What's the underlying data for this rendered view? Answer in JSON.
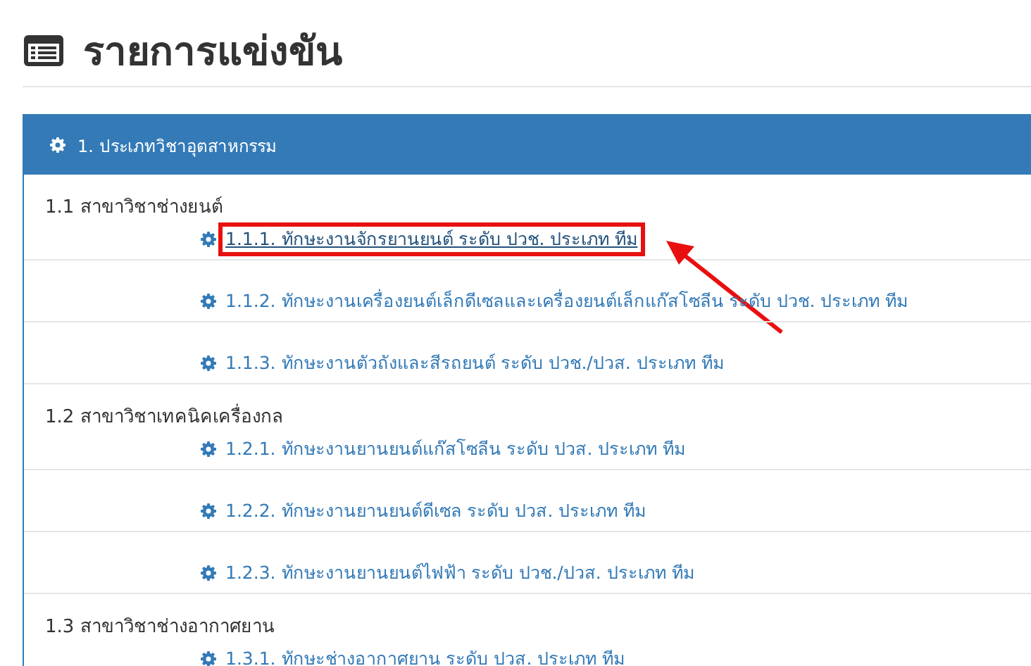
{
  "page": {
    "title": "รายการแข่งขัน"
  },
  "panel": {
    "title": "1. ประเภทวิชาอุตสาหกรรม",
    "groups": [
      {
        "label": "1.1 สาขาวิชาช่างยนต์",
        "items": [
          {
            "label": "1.1.1. ทักษะงานจักรยานยนต์ ระดับ ปวช. ประเภท ทีม",
            "highlighted": true
          },
          {
            "label": "1.1.2. ทักษะงานเครื่องยนต์เล็กดีเซลและเครื่องยนต์เล็กแก๊สโซลีน ระดับ ปวช. ประเภท ทีม",
            "highlighted": false
          },
          {
            "label": "1.1.3. ทักษะงานตัวถังและสีรถยนต์ ระดับ ปวช./ปวส. ประเภท ทีม",
            "highlighted": false
          }
        ]
      },
      {
        "label": "1.2 สาขาวิชาเทคนิคเครื่องกล",
        "items": [
          {
            "label": "1.2.1. ทักษะงานยานยนต์แก๊สโซลีน ระดับ ปวส. ประเภท ทีม",
            "highlighted": false
          },
          {
            "label": "1.2.2. ทักษะงานยานยนต์ดีเซล ระดับ ปวส. ประเภท ทีม",
            "highlighted": false
          },
          {
            "label": "1.2.3. ทักษะงานยานยนต์ไฟฟ้า ระดับ ปวช./ปวส. ประเภท ทีม",
            "highlighted": false
          }
        ]
      },
      {
        "label": "1.3 สาขาวิชาช่างอากาศยาน",
        "items": [
          {
            "label": "1.3.1. ทักษะช่างอากาศยาน ระดับ ปวส. ประเภท ทีม",
            "highlighted": false
          }
        ]
      }
    ]
  }
}
